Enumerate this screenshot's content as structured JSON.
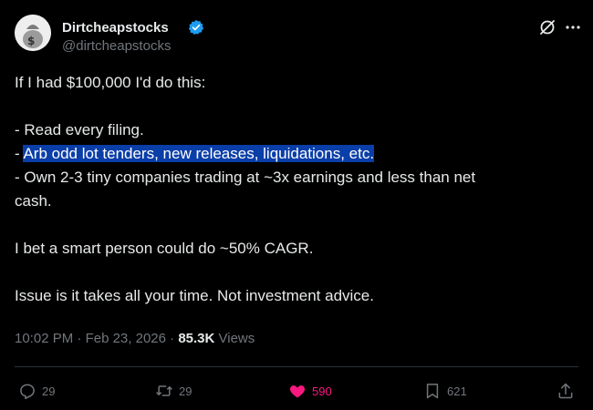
{
  "author": {
    "name": "Dirtcheapstocks",
    "handle": "@dirtcheapstocks",
    "verified": true
  },
  "tweet": {
    "lines": [
      "If I had $100,000 I'd do this:",
      "",
      "- Read every filing.",
      "Arb odd lot tenders, new releases, liquidations, etc.",
      "- Own 2-3 tiny companies trading at ~3x earnings and less than net",
      "cash.",
      "",
      "I bet a smart person could do ~50% CAGR.",
      "",
      "Issue is it takes all your time. Not investment advice."
    ],
    "highlight_prefix": "- "
  },
  "meta": {
    "time": "10:02 PM",
    "separator": " · ",
    "date": "Feb 23, 2026",
    "views_count": "85.3K",
    "views_label": " Views"
  },
  "actions": {
    "replies": "29",
    "reposts": "29",
    "likes": "590",
    "bookmarks": "621"
  },
  "colors": {
    "background": "#000000",
    "text": "#e7e9ea",
    "muted": "#71767b",
    "verified": "#1d9bf0",
    "like": "#f91880",
    "highlight": "#0a3ea8"
  },
  "icons": [
    "verified-badge-icon",
    "grok-icon",
    "more-icon",
    "reply-icon",
    "repost-icon",
    "like-icon",
    "bookmark-icon",
    "share-icon"
  ]
}
